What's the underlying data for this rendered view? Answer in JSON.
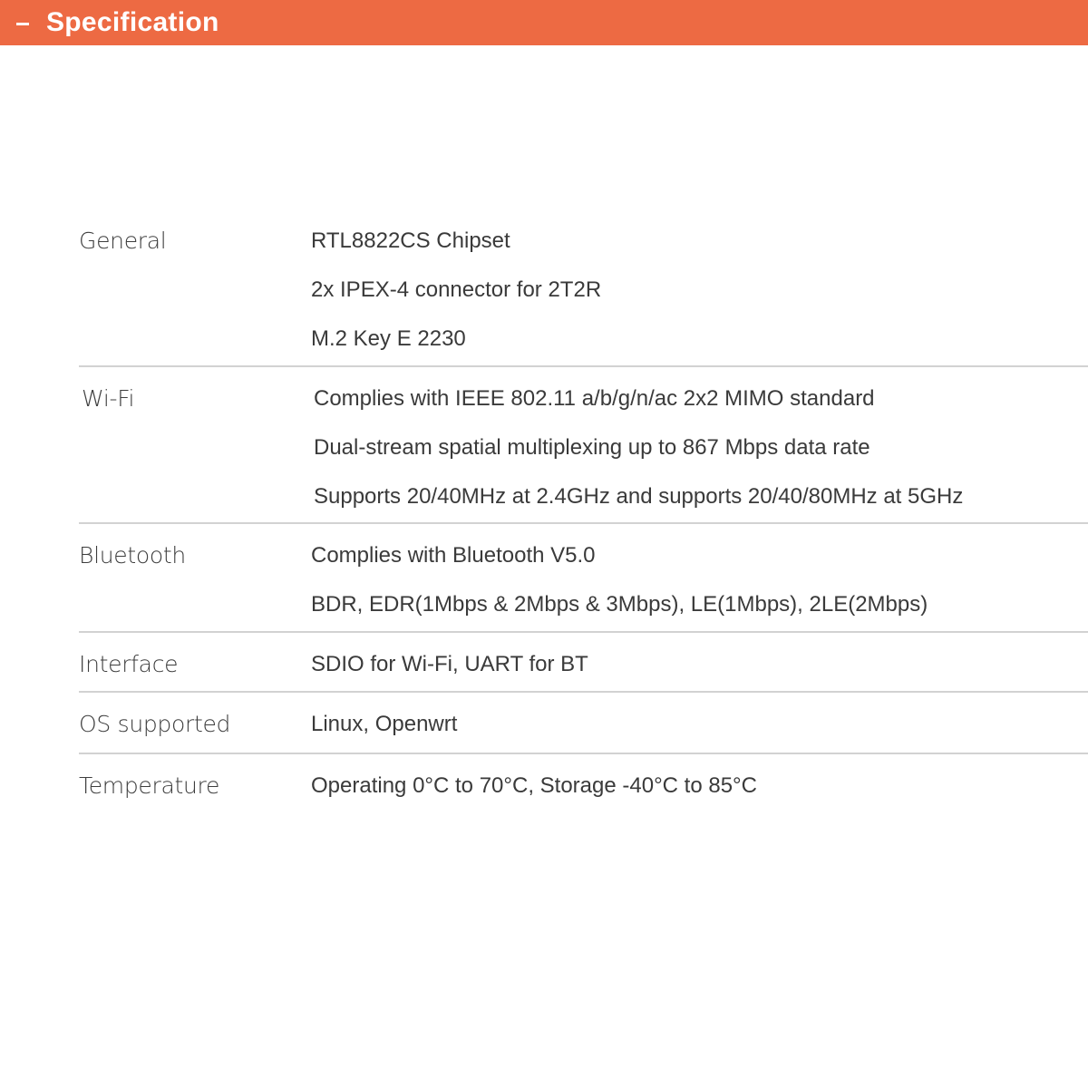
{
  "header": {
    "title": "Specification",
    "background_color": "#ed6a43",
    "collapse_icon": "minus-icon"
  },
  "spec": {
    "rows": [
      {
        "label": "General",
        "values": [
          "RTL8822CS Chipset",
          "2x IPEX-4 connector for 2T2R",
          "M.2 Key E 2230"
        ]
      },
      {
        "label": "Wi-Fi",
        "values": [
          "Complies with IEEE 802.11 a/b/g/n/ac 2x2 MIMO standard",
          "Dual-stream spatial multiplexing up to 867 Mbps data rate",
          "Supports 20/40MHz at 2.4GHz and supports 20/40/80MHz at 5GHz"
        ]
      },
      {
        "label": "Bluetooth",
        "values": [
          "Complies with Bluetooth V5.0",
          "BDR, EDR(1Mbps & 2Mbps & 3Mbps), LE(1Mbps), 2LE(2Mbps)"
        ]
      },
      {
        "label": "Interface",
        "values": [
          "SDIO for Wi-Fi, UART for BT"
        ]
      },
      {
        "label": "OS supported",
        "values": [
          "Linux, Openwrt"
        ]
      },
      {
        "label": "Temperature",
        "values": [
          "Operating 0°C to 70°C, Storage -40°C to 85°C"
        ]
      }
    ]
  }
}
